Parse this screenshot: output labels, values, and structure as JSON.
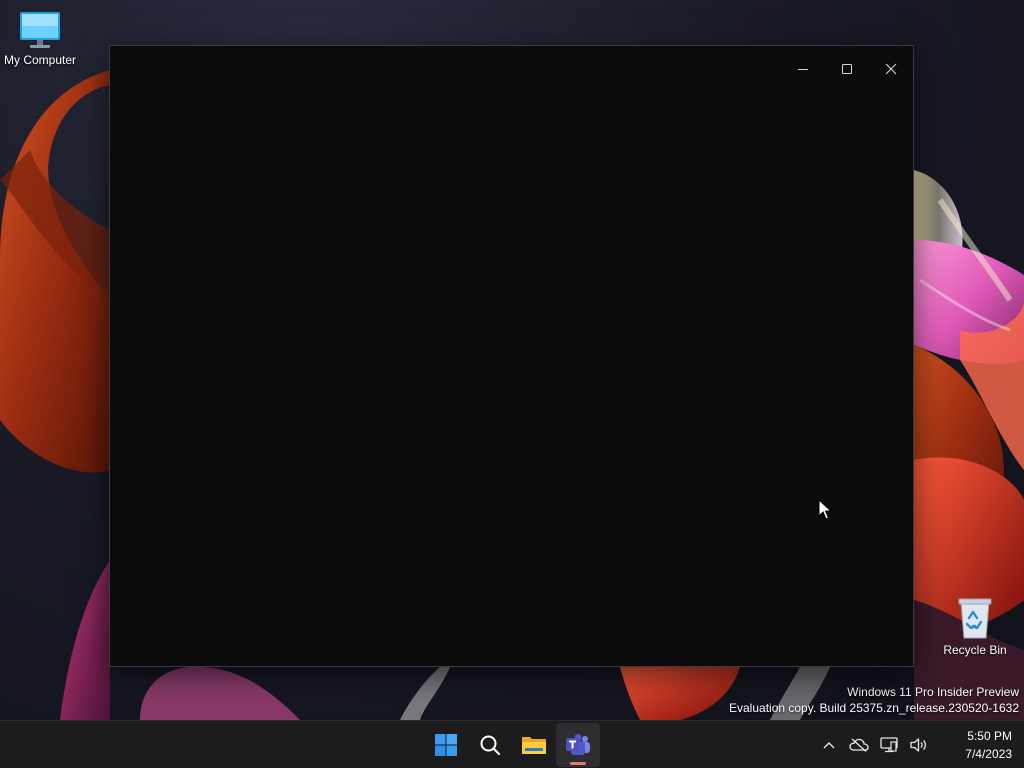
{
  "desktop": {
    "icons": [
      {
        "label": "My Computer"
      },
      {
        "label": "Recycle Bin"
      }
    ],
    "watermark": {
      "line1": "Windows 11 Pro Insider Preview",
      "line2": "Evaluation copy. Build 25375.zn_release.230520-1632"
    }
  },
  "window": {
    "title": "",
    "background": "#0b0b0c",
    "caption_buttons": [
      {
        "icon": "minimize-icon"
      },
      {
        "icon": "maximize-icon"
      },
      {
        "icon": "close-icon"
      }
    ]
  },
  "taskbar": {
    "apps": [
      {
        "icon": "windows-start-icon",
        "active": false
      },
      {
        "icon": "search-icon",
        "active": false
      },
      {
        "icon": "file-explorer-icon",
        "active": false
      },
      {
        "icon": "teams-icon",
        "active": true
      }
    ],
    "tray": [
      {
        "icon": "chevron-up-icon"
      },
      {
        "icon": "onedrive-offline-icon"
      },
      {
        "icon": "network-icon"
      },
      {
        "icon": "volume-icon"
      }
    ],
    "clock": {
      "time": "5:50 PM",
      "date": "7/4/2023"
    }
  },
  "colors": {
    "accent_indicator": "#e8796b",
    "taskbar_bg": "#1c1c1e",
    "start_blue": "#3a9bf0"
  }
}
